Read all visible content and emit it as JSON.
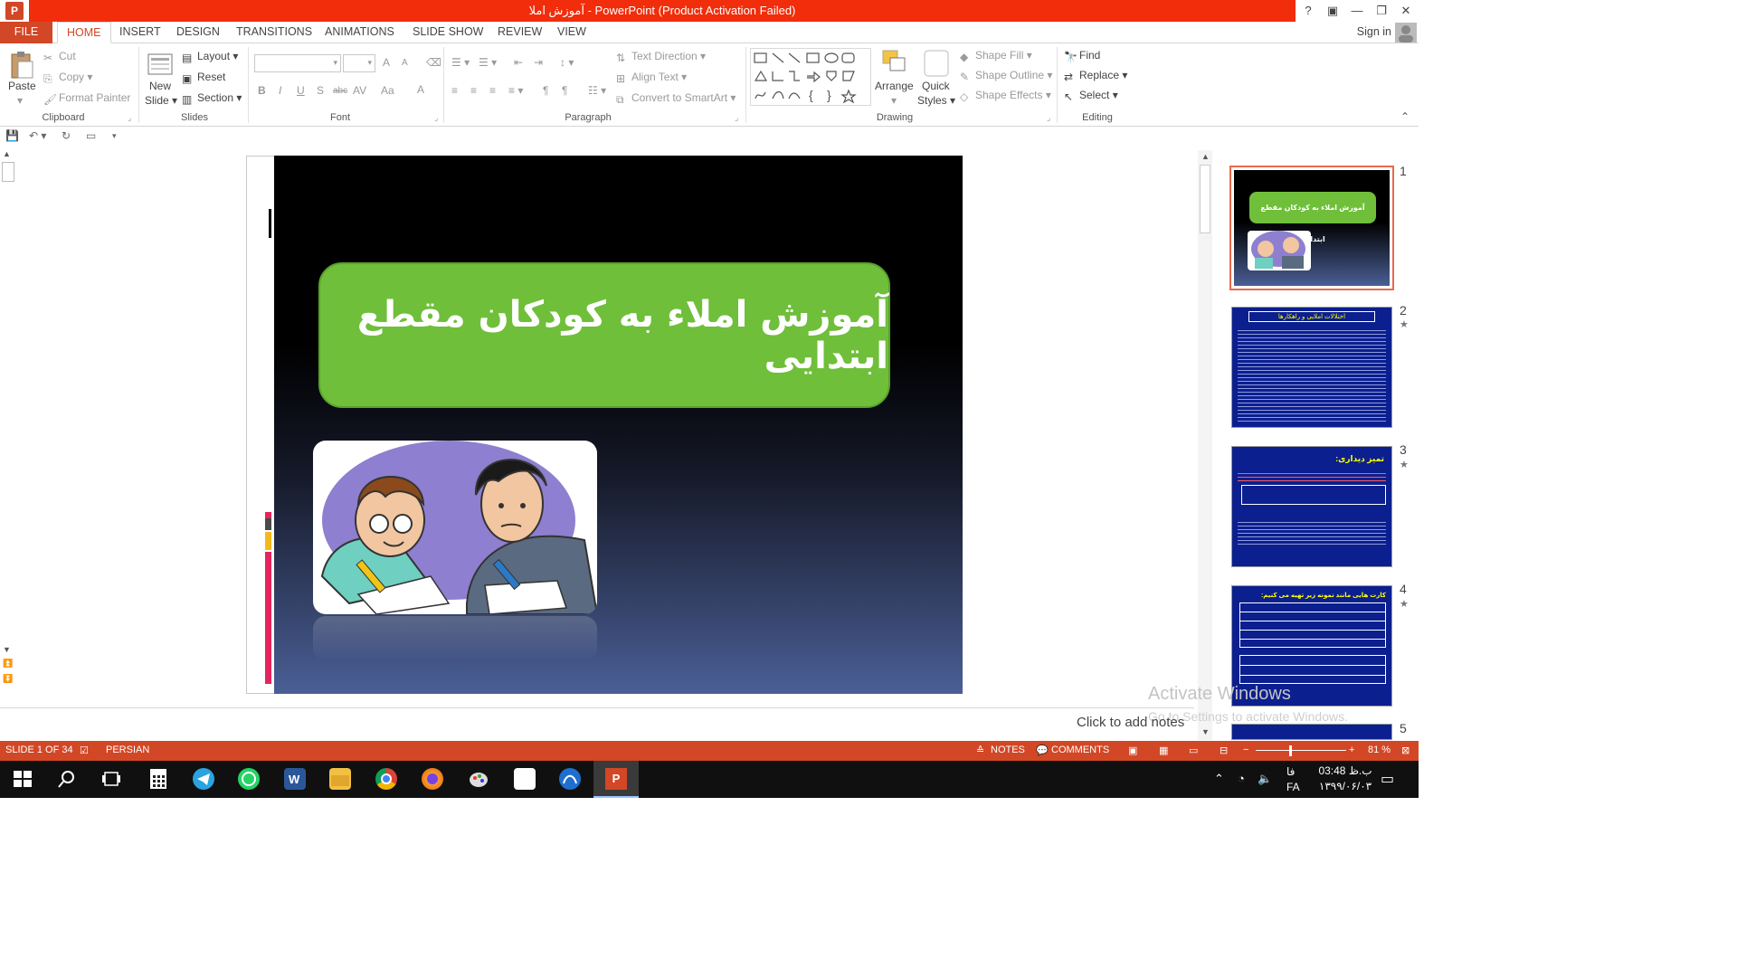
{
  "window": {
    "title": "آموزش املا  -  PowerPoint (Product Activation Failed)",
    "app_logo": "P",
    "controls": [
      "?",
      "▣",
      "—",
      "❐",
      "✕"
    ]
  },
  "tabs": [
    "FILE",
    "HOME",
    "INSERT",
    "DESIGN",
    "TRANSITIONS",
    "ANIMATIONS",
    "SLIDE SHOW",
    "REVIEW",
    "VIEW"
  ],
  "signin": "Sign in",
  "ribbon": {
    "clipboard": {
      "label": "Clipboard",
      "paste": "Paste",
      "cut": "Cut",
      "copy": "Copy",
      "format_painter": "Format Painter"
    },
    "slides": {
      "label": "Slides",
      "new_slide_1": "New",
      "new_slide_2": "Slide",
      "layout": "Layout",
      "reset": "Reset",
      "section": "Section"
    },
    "font": {
      "label": "Font",
      "bold": "B",
      "italic": "I",
      "underline": "U",
      "shadow": "S",
      "strike": "abc",
      "spacing": "AV",
      "case": "Aa",
      "color": "A",
      "grow": "A",
      "shrink": "A"
    },
    "paragraph": {
      "label": "Paragraph",
      "text_direction": "Text Direction",
      "align_text": "Align Text",
      "smartart": "Convert to SmartArt"
    },
    "drawing": {
      "label": "Drawing",
      "arrange": "Arrange",
      "quick_styles_1": "Quick",
      "quick_styles_2": "Styles",
      "shape_fill": "Shape Fill",
      "shape_outline": "Shape Outline",
      "shape_effects": "Shape Effects"
    },
    "editing": {
      "label": "Editing",
      "find": "Find",
      "replace": "Replace",
      "select": "Select"
    }
  },
  "slide": {
    "title": "آموزش املاء به کودکان مقطع ابتدایی"
  },
  "thumbnails": [
    {
      "num": "1",
      "title": "آموزش املاء به کودکان مقطع ابتدایی"
    },
    {
      "num": "2",
      "heading": "اختلالات املایی و راهکارها"
    },
    {
      "num": "3",
      "heading": "تمیز دیداری:"
    },
    {
      "num": "4",
      "heading": "کارت هایی مانند نمونه زیر تهیه می کنیم:"
    },
    {
      "num": "5"
    }
  ],
  "notes_placeholder": "Click to add notes",
  "watermark": {
    "line1": "Activate Windows",
    "line2": "Go to Settings to activate Windows."
  },
  "status": {
    "slide_of": "SLIDE 1 OF 34",
    "language": "PERSIAN",
    "notes": "NOTES",
    "comments": "COMMENTS",
    "zoom": "81 %"
  },
  "taskbar": {
    "time": "03:48 ب.ظ",
    "date": "۱۳۹۹/۰۶/۰۳",
    "lang_1": "فا",
    "lang_2": "FA"
  },
  "colors": {
    "accent": "#d24726",
    "title_bar": "#f12d0b",
    "slide_title_box": "#6fbf3a"
  }
}
